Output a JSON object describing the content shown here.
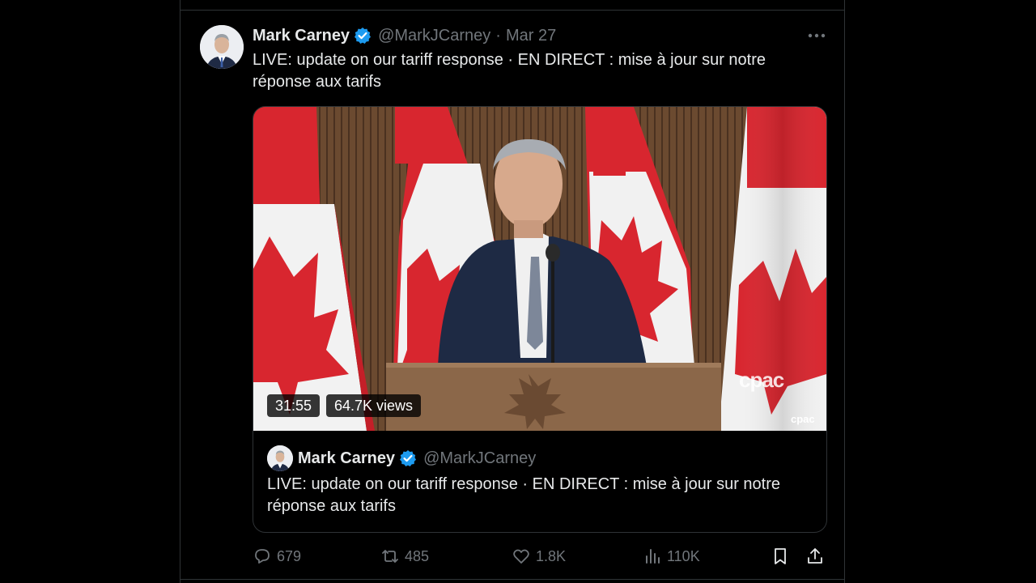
{
  "post": {
    "author_name": "Mark Carney",
    "handle": "@MarkJCarney",
    "separator": "·",
    "date": "Mar 27",
    "text": "LIVE: update on our tariff response · EN DIRECT : mise à jour sur notre réponse aux tarifs"
  },
  "video": {
    "duration": "31:55",
    "views": "64.7K views",
    "watermark": "cpac",
    "corner_logo": "cpac"
  },
  "quote": {
    "author_name": "Mark Carney",
    "handle": "@MarkJCarney",
    "text": "LIVE: update on our tariff response · EN DIRECT : mise à jour sur notre réponse aux tarifs"
  },
  "actions": {
    "replies": "679",
    "reposts": "485",
    "likes": "1.8K",
    "views": "110K"
  },
  "icons": {
    "verified": "verified-badge-icon",
    "more": "more-icon",
    "reply": "reply-icon",
    "repost": "repost-icon",
    "like": "heart-icon",
    "views": "analytics-icon",
    "bookmark": "bookmark-icon",
    "share": "share-icon"
  },
  "colors": {
    "background": "#000000",
    "text": "#e7e9ea",
    "muted": "#71767b",
    "border": "#2f3336",
    "verified": "#1d9bf0",
    "flag_red": "#d8262f"
  }
}
